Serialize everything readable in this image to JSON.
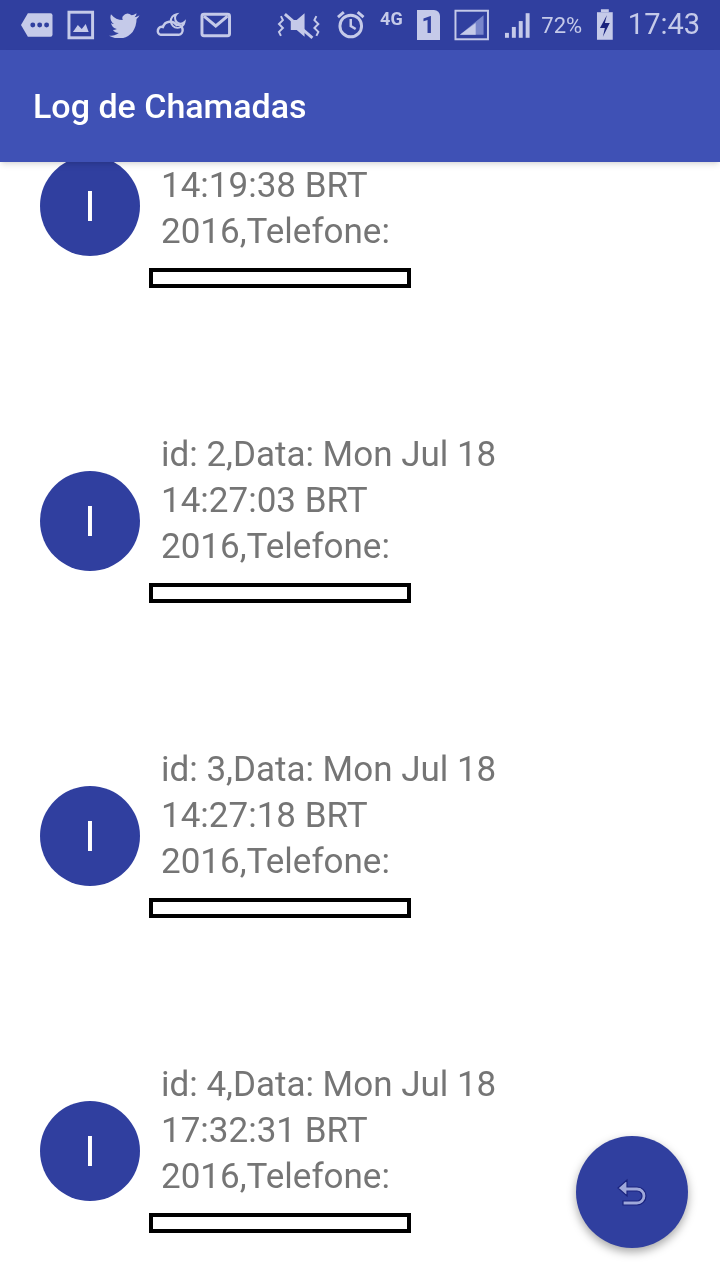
{
  "status_bar": {
    "network": "4G",
    "sim": "1",
    "battery": "72%",
    "time": "17:43"
  },
  "app_bar": {
    "title": "Log de Chamadas"
  },
  "calls": [
    {
      "avatar": "I",
      "lines": [
        "14:19:38 BRT",
        "2016,Telefone:"
      ]
    },
    {
      "avatar": "I",
      "lines": [
        "id: 2,Data: Mon Jul 18",
        "14:27:03 BRT",
        "2016,Telefone:"
      ]
    },
    {
      "avatar": "I",
      "lines": [
        "id: 3,Data: Mon Jul 18",
        "14:27:18 BRT",
        "2016,Telefone:"
      ]
    },
    {
      "avatar": "I",
      "lines": [
        "id: 4,Data: Mon Jul 18",
        "17:32:31 BRT",
        "2016,Telefone:"
      ]
    }
  ]
}
